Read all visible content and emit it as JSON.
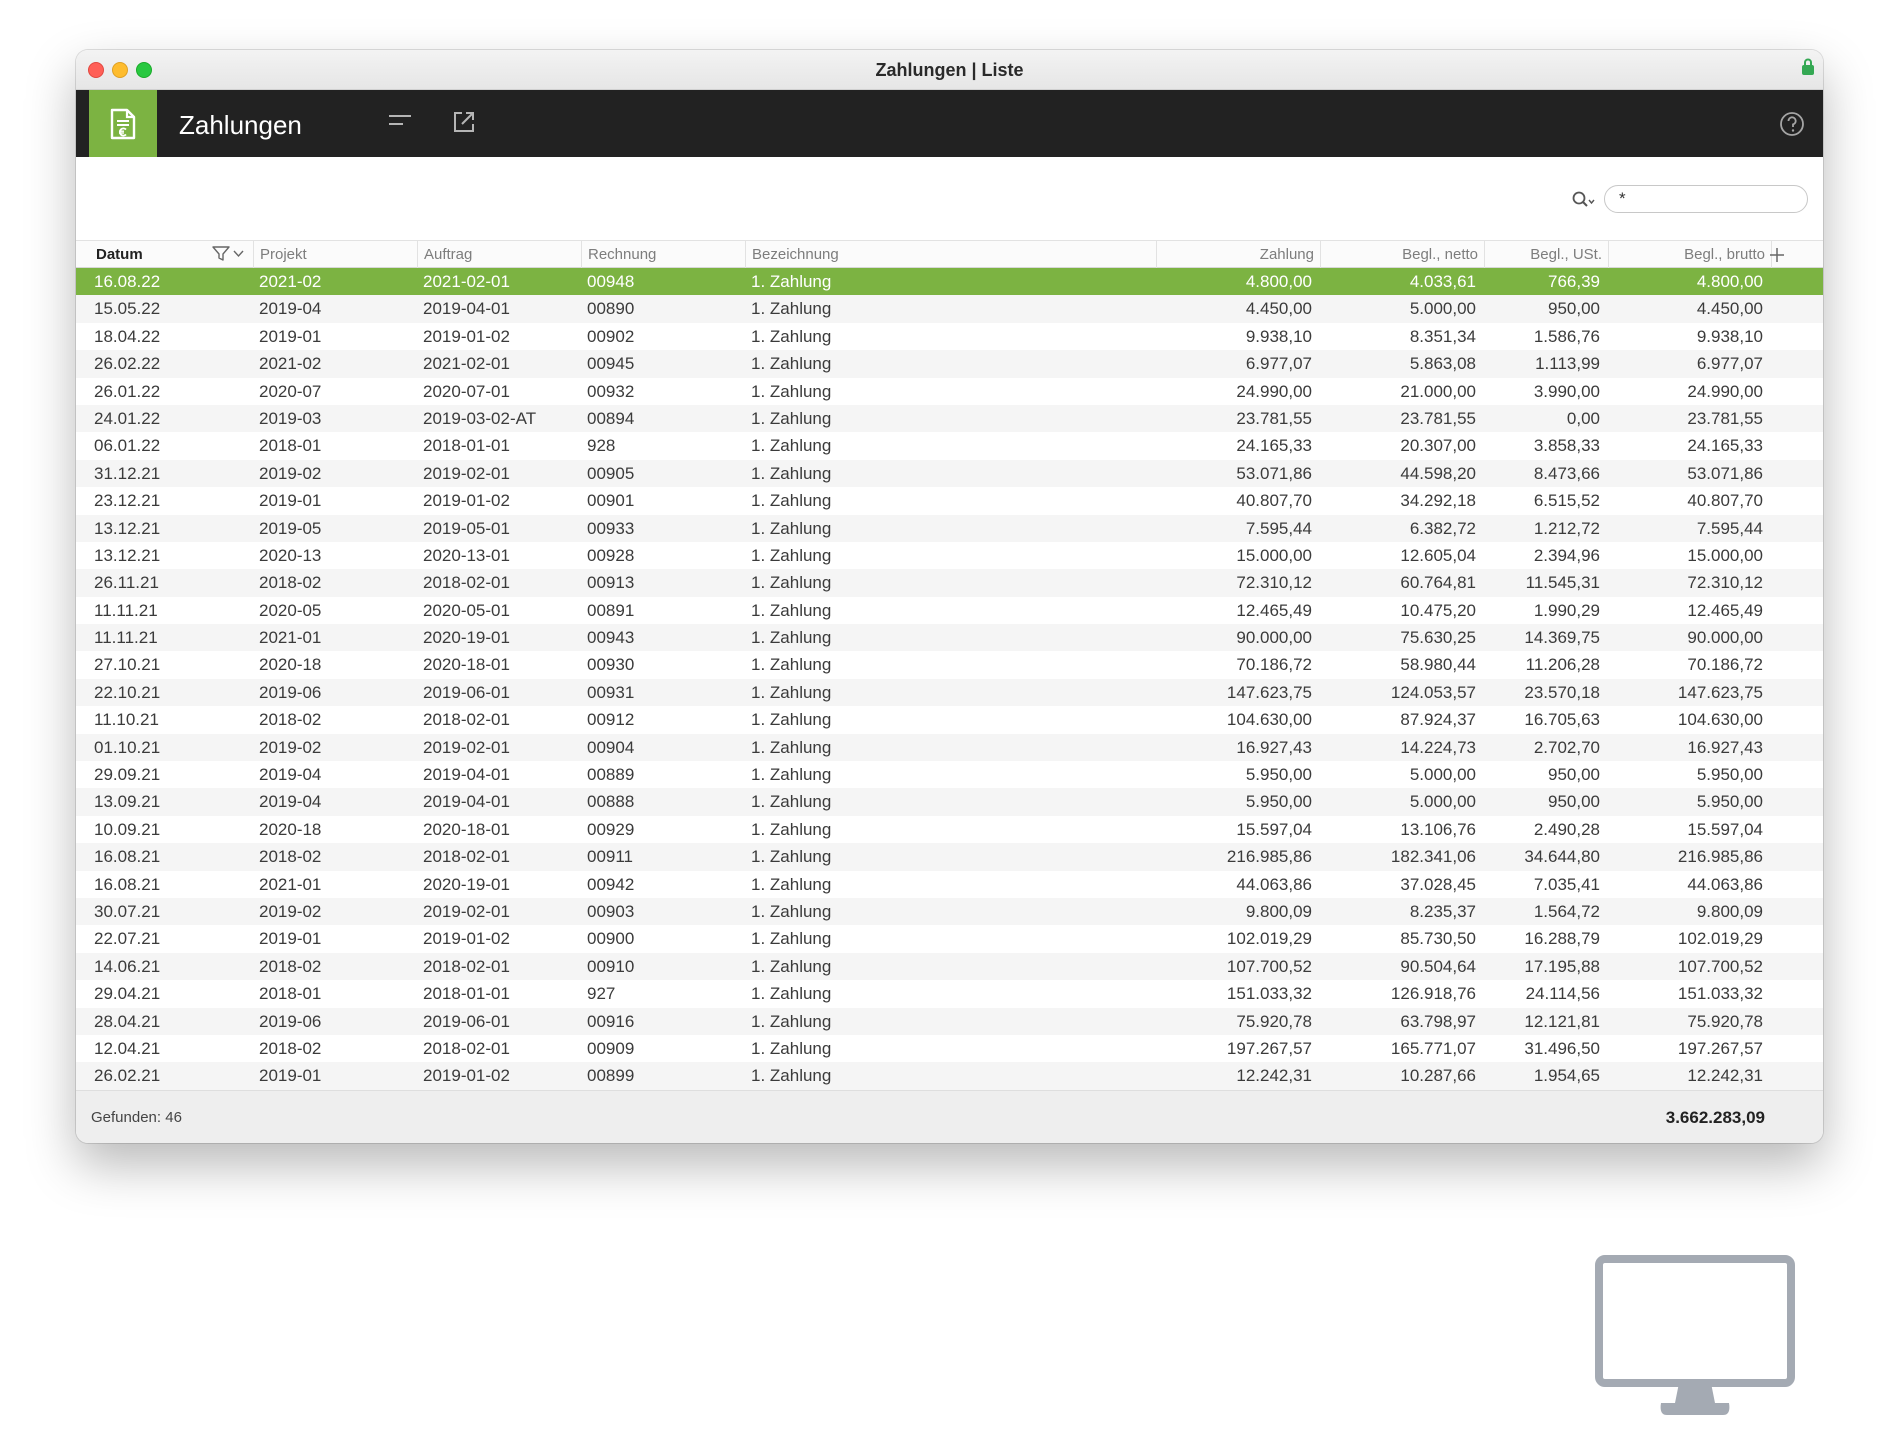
{
  "window": {
    "title": "Zahlungen | Liste"
  },
  "app": {
    "title": "Zahlungen"
  },
  "search": {
    "value": "*"
  },
  "columns": [
    {
      "key": "datum",
      "label": "Datum"
    },
    {
      "key": "projekt",
      "label": "Projekt"
    },
    {
      "key": "auftrag",
      "label": "Auftrag"
    },
    {
      "key": "rechnung",
      "label": "Rechnung"
    },
    {
      "key": "bezeichnung",
      "label": "Bezeichnung"
    },
    {
      "key": "zahlung",
      "label": "Zahlung"
    },
    {
      "key": "netto",
      "label": "Begl., netto"
    },
    {
      "key": "ust",
      "label": "Begl., USt."
    },
    {
      "key": "brutto",
      "label": "Begl., brutto"
    }
  ],
  "rows": [
    [
      "16.08.22",
      "2021-02",
      "2021-02-01",
      "00948",
      "1. Zahlung",
      "4.800,00",
      "4.033,61",
      "766,39",
      "4.800,00"
    ],
    [
      "15.05.22",
      "2019-04",
      "2019-04-01",
      "00890",
      "1. Zahlung",
      "4.450,00",
      "5.000,00",
      "950,00",
      "4.450,00"
    ],
    [
      "18.04.22",
      "2019-01",
      "2019-01-02",
      "00902",
      "1. Zahlung",
      "9.938,10",
      "8.351,34",
      "1.586,76",
      "9.938,10"
    ],
    [
      "26.02.22",
      "2021-02",
      "2021-02-01",
      "00945",
      "1. Zahlung",
      "6.977,07",
      "5.863,08",
      "1.113,99",
      "6.977,07"
    ],
    [
      "26.01.22",
      "2020-07",
      "2020-07-01",
      "00932",
      "1. Zahlung",
      "24.990,00",
      "21.000,00",
      "3.990,00",
      "24.990,00"
    ],
    [
      "24.01.22",
      "2019-03",
      "2019-03-02-AT",
      "00894",
      "1. Zahlung",
      "23.781,55",
      "23.781,55",
      "0,00",
      "23.781,55"
    ],
    [
      "06.01.22",
      "2018-01",
      "2018-01-01",
      "928",
      "1. Zahlung",
      "24.165,33",
      "20.307,00",
      "3.858,33",
      "24.165,33"
    ],
    [
      "31.12.21",
      "2019-02",
      "2019-02-01",
      "00905",
      "1. Zahlung",
      "53.071,86",
      "44.598,20",
      "8.473,66",
      "53.071,86"
    ],
    [
      "23.12.21",
      "2019-01",
      "2019-01-02",
      "00901",
      "1. Zahlung",
      "40.807,70",
      "34.292,18",
      "6.515,52",
      "40.807,70"
    ],
    [
      "13.12.21",
      "2019-05",
      "2019-05-01",
      "00933",
      "1. Zahlung",
      "7.595,44",
      "6.382,72",
      "1.212,72",
      "7.595,44"
    ],
    [
      "13.12.21",
      "2020-13",
      "2020-13-01",
      "00928",
      "1. Zahlung",
      "15.000,00",
      "12.605,04",
      "2.394,96",
      "15.000,00"
    ],
    [
      "26.11.21",
      "2018-02",
      "2018-02-01",
      "00913",
      "1. Zahlung",
      "72.310,12",
      "60.764,81",
      "11.545,31",
      "72.310,12"
    ],
    [
      "11.11.21",
      "2020-05",
      "2020-05-01",
      "00891",
      "1. Zahlung",
      "12.465,49",
      "10.475,20",
      "1.990,29",
      "12.465,49"
    ],
    [
      "11.11.21",
      "2021-01",
      "2020-19-01",
      "00943",
      "1. Zahlung",
      "90.000,00",
      "75.630,25",
      "14.369,75",
      "90.000,00"
    ],
    [
      "27.10.21",
      "2020-18",
      "2020-18-01",
      "00930",
      "1. Zahlung",
      "70.186,72",
      "58.980,44",
      "11.206,28",
      "70.186,72"
    ],
    [
      "22.10.21",
      "2019-06",
      "2019-06-01",
      "00931",
      "1. Zahlung",
      "147.623,75",
      "124.053,57",
      "23.570,18",
      "147.623,75"
    ],
    [
      "11.10.21",
      "2018-02",
      "2018-02-01",
      "00912",
      "1. Zahlung",
      "104.630,00",
      "87.924,37",
      "16.705,63",
      "104.630,00"
    ],
    [
      "01.10.21",
      "2019-02",
      "2019-02-01",
      "00904",
      "1. Zahlung",
      "16.927,43",
      "14.224,73",
      "2.702,70",
      "16.927,43"
    ],
    [
      "29.09.21",
      "2019-04",
      "2019-04-01",
      "00889",
      "1. Zahlung",
      "5.950,00",
      "5.000,00",
      "950,00",
      "5.950,00"
    ],
    [
      "13.09.21",
      "2019-04",
      "2019-04-01",
      "00888",
      "1. Zahlung",
      "5.950,00",
      "5.000,00",
      "950,00",
      "5.950,00"
    ],
    [
      "10.09.21",
      "2020-18",
      "2020-18-01",
      "00929",
      "1. Zahlung",
      "15.597,04",
      "13.106,76",
      "2.490,28",
      "15.597,04"
    ],
    [
      "16.08.21",
      "2018-02",
      "2018-02-01",
      "00911",
      "1. Zahlung",
      "216.985,86",
      "182.341,06",
      "34.644,80",
      "216.985,86"
    ],
    [
      "16.08.21",
      "2021-01",
      "2020-19-01",
      "00942",
      "1. Zahlung",
      "44.063,86",
      "37.028,45",
      "7.035,41",
      "44.063,86"
    ],
    [
      "30.07.21",
      "2019-02",
      "2019-02-01",
      "00903",
      "1. Zahlung",
      "9.800,09",
      "8.235,37",
      "1.564,72",
      "9.800,09"
    ],
    [
      "22.07.21",
      "2019-01",
      "2019-01-02",
      "00900",
      "1. Zahlung",
      "102.019,29",
      "85.730,50",
      "16.288,79",
      "102.019,29"
    ],
    [
      "14.06.21",
      "2018-02",
      "2018-02-01",
      "00910",
      "1. Zahlung",
      "107.700,52",
      "90.504,64",
      "17.195,88",
      "107.700,52"
    ],
    [
      "29.04.21",
      "2018-01",
      "2018-01-01",
      "927",
      "1. Zahlung",
      "151.033,32",
      "126.918,76",
      "24.114,56",
      "151.033,32"
    ],
    [
      "28.04.21",
      "2019-06",
      "2019-06-01",
      "00916",
      "1. Zahlung",
      "75.920,78",
      "63.798,97",
      "12.121,81",
      "75.920,78"
    ],
    [
      "12.04.21",
      "2018-02",
      "2018-02-01",
      "00909",
      "1. Zahlung",
      "197.267,57",
      "165.771,07",
      "31.496,50",
      "197.267,57"
    ],
    [
      "26.02.21",
      "2019-01",
      "2019-01-02",
      "00899",
      "1. Zahlung",
      "12.242,31",
      "10.287,66",
      "1.954,65",
      "12.242,31"
    ]
  ],
  "selected_row": 0,
  "footer": {
    "found": "Gefunden: 46",
    "total": "3.662.283,09"
  },
  "colors": {
    "accent": "#7cb342",
    "appbar": "#222222"
  },
  "icons": [
    "document-euro-icon",
    "menu-icon",
    "export-icon",
    "help-icon",
    "search-icon",
    "filter-icon",
    "add-column-icon",
    "lock-icon",
    "monitor-icon"
  ]
}
